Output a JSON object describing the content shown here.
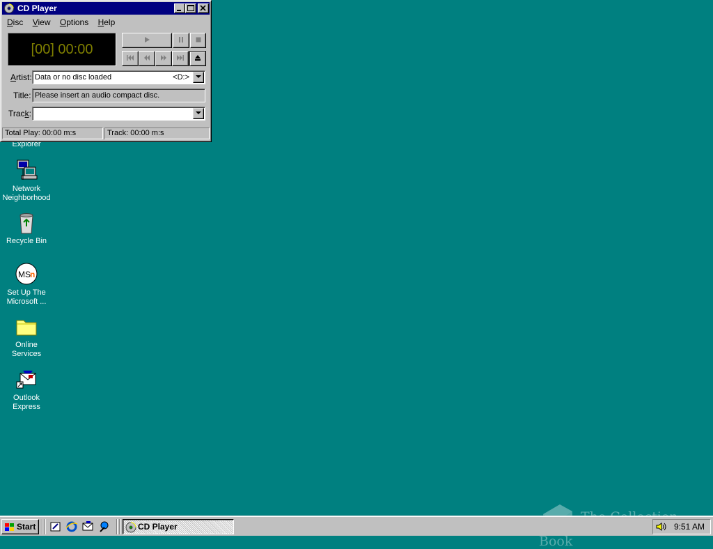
{
  "desktop": {
    "icons": [
      {
        "label": "Explorer",
        "icon": "internet-explorer-icon"
      },
      {
        "label": "Network\nNeighborhood",
        "icon": "network-neighborhood-icon"
      },
      {
        "label": "Recycle Bin",
        "icon": "recycle-bin-icon"
      },
      {
        "label": "Set Up The\nMicrosoft ...",
        "icon": "msn-icon"
      },
      {
        "label": "Online\nServices",
        "icon": "folder-icon"
      },
      {
        "label": "Outlook\nExpress",
        "icon": "outlook-express-icon"
      }
    ],
    "background_color": "#008080"
  },
  "cd_player": {
    "title": "CD Player",
    "menu": [
      {
        "label": "Disc",
        "underline": "D"
      },
      {
        "label": "View",
        "underline": "V"
      },
      {
        "label": "Options",
        "underline": "O"
      },
      {
        "label": "Help",
        "underline": "H"
      }
    ],
    "display": "[00] 00:00",
    "display_color": "#808000",
    "artist_label": "Artist:",
    "artist_value": "Data or no disc loaded",
    "drive": "<D:>",
    "title_label": "Title:",
    "title_value": "Please insert an audio compact disc.",
    "track_label": "Track:",
    "track_value": "",
    "status_total": "Total Play: 00:00 m:s",
    "status_track": "Track: 00:00 m:s"
  },
  "taskbar": {
    "start_label": "Start",
    "task_label": "CD Player",
    "clock": "9:51 AM",
    "quick_launch": [
      "show-desktop-icon",
      "internet-explorer-icon",
      "outlook-express-icon",
      "channels-icon"
    ]
  },
  "watermark": "The Collection Book"
}
